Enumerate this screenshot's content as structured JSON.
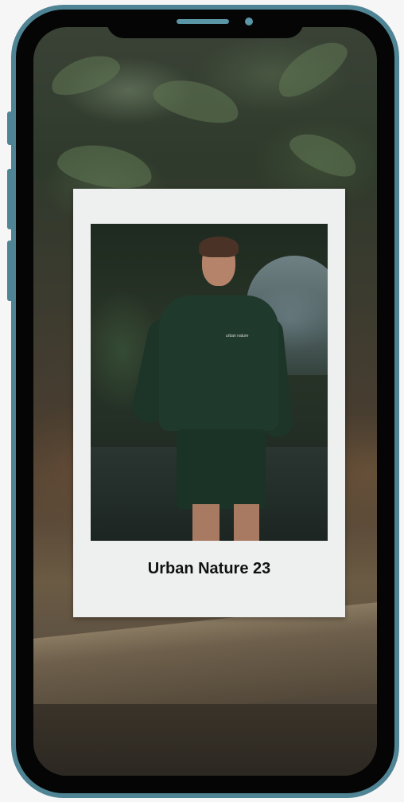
{
  "device": {
    "frame_color": "#4f8494",
    "bezel_color": "#050505",
    "indicator_color": "#5a96a6"
  },
  "card": {
    "caption": "Urban Nature 23",
    "shirt_print": "urban nature"
  }
}
